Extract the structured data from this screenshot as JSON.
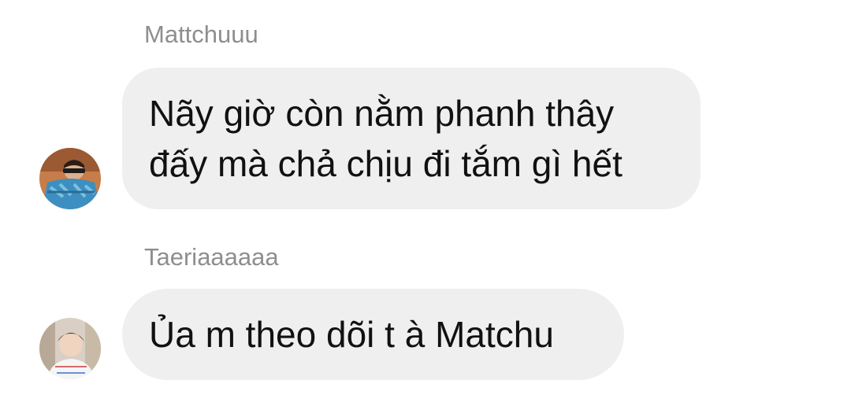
{
  "messages": [
    {
      "sender": "Mattchuuu",
      "lines": [
        "Nãy giờ còn nằm phanh thây",
        "đấy mà chả chịu đi tắm gì hết"
      ]
    },
    {
      "sender": "Taeriaaaaaa",
      "lines": [
        "Ủa m theo dõi t à Matchu"
      ]
    }
  ]
}
